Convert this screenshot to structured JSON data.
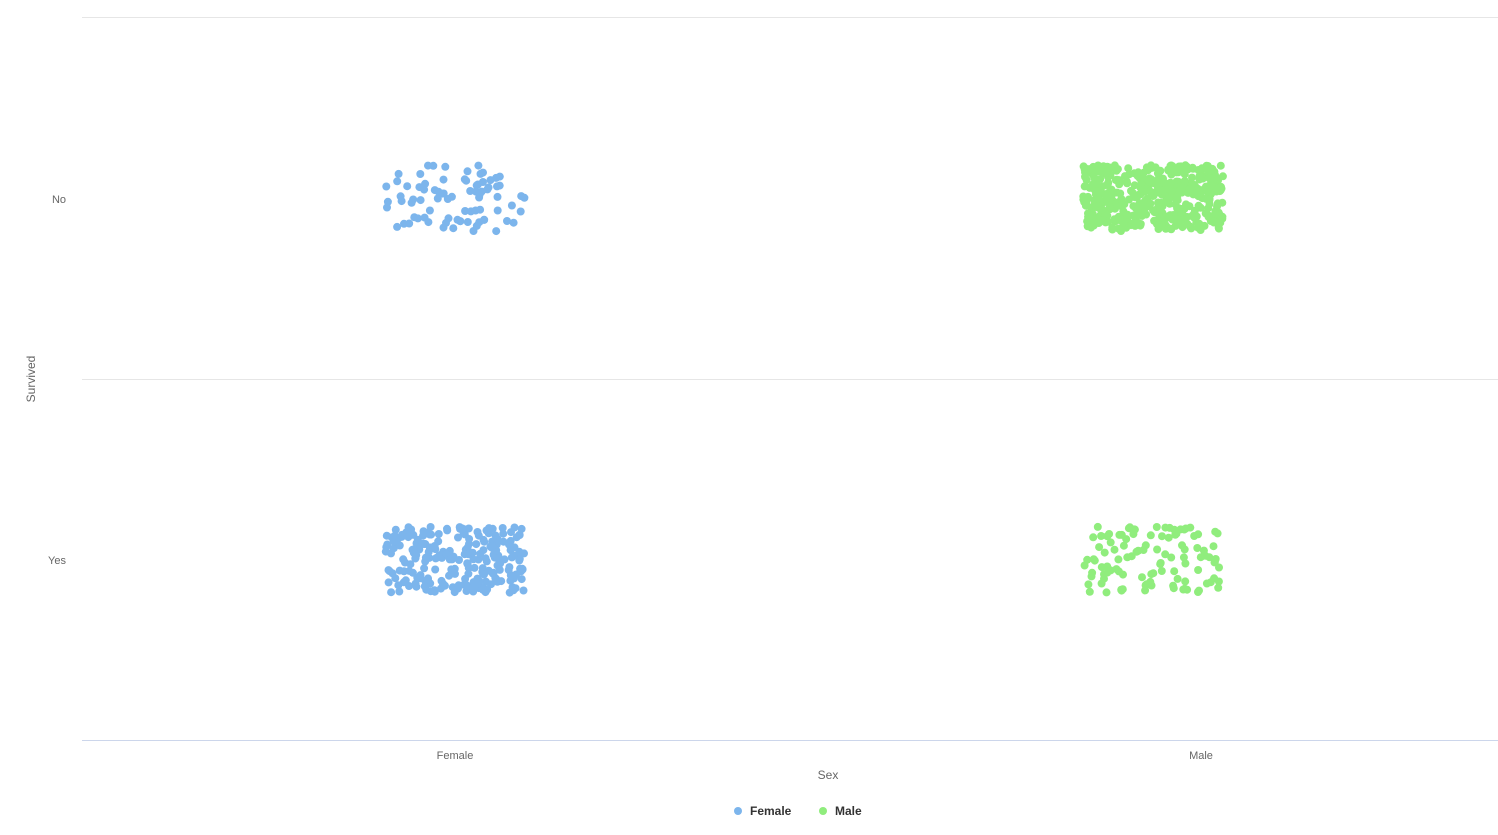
{
  "chart_data": {
    "type": "scatter",
    "subtype": "jitter",
    "xlabel": "Sex",
    "ylabel": "Survived",
    "x_categories": [
      "Female",
      "Male"
    ],
    "y_categories": [
      "No",
      "Yes"
    ],
    "grid": true,
    "legend_position": "bottom",
    "series": [
      {
        "name": "Female",
        "color": "#7cb5ec",
        "counts": {
          "No": 81,
          "Yes": 233
        }
      },
      {
        "name": "Male",
        "color": "#90ed7d",
        "counts": {
          "No": 468,
          "Yes": 109
        }
      }
    ],
    "jitter_width": 0.19,
    "jitter_height": 0.19
  }
}
